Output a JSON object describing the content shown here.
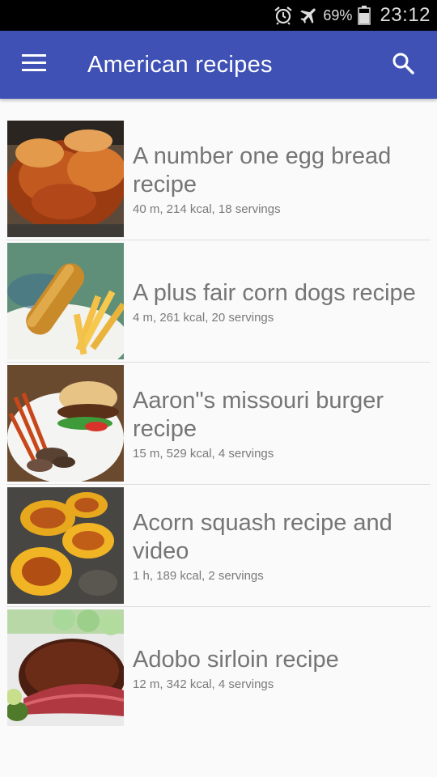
{
  "status_bar": {
    "battery_percent": "69%",
    "time": "23:12",
    "icons": [
      "alarm-clock-icon",
      "airplane-mode-icon",
      "battery-icon"
    ]
  },
  "app_bar": {
    "title": "American recipes",
    "background_color": "#3f51b5",
    "icons": [
      "menu-icon",
      "search-icon"
    ]
  },
  "recipes": [
    {
      "title": "A number one egg bread recipe",
      "meta": "40 m, 214 kcal, 18 servings",
      "image": "egg-bread-photo"
    },
    {
      "title": "A plus fair corn dogs recipe",
      "meta": "4 m, 261 kcal, 20 servings",
      "image": "corn-dog-photo"
    },
    {
      "title": "Aaron\"s missouri burger recipe",
      "meta": "15 m, 529 kcal, 4 servings",
      "image": "burger-photo"
    },
    {
      "title": "Acorn squash recipe and video",
      "meta": "1 h, 189 kcal, 2 servings",
      "image": "acorn-squash-photo"
    },
    {
      "title": "Adobo sirloin recipe",
      "meta": "12 m, 342 kcal, 4 servings",
      "image": "sirloin-photo"
    }
  ]
}
